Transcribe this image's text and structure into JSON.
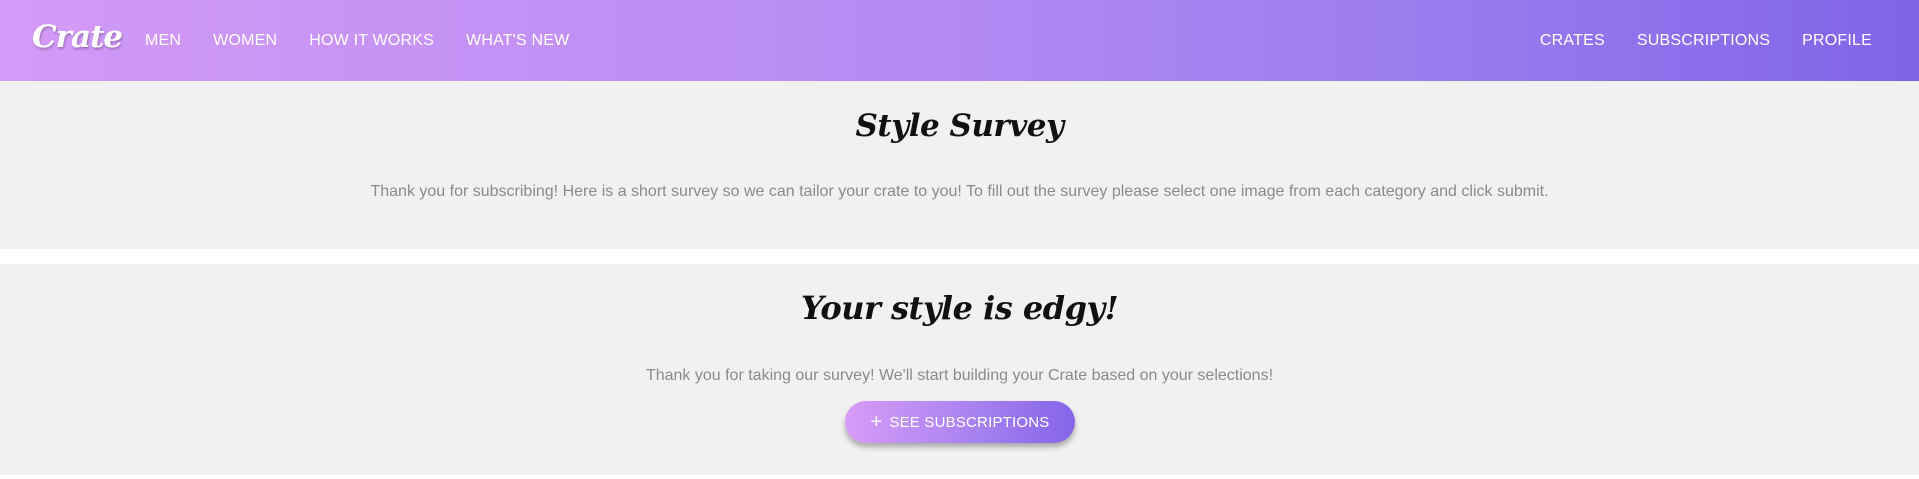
{
  "navbar": {
    "logo": "Crate",
    "left_links": [
      "MEN",
      "WOMEN",
      "HOW IT WORKS",
      "WHAT'S NEW"
    ],
    "right_links": [
      "CRATES",
      "SUBSCRIPTIONS",
      "PROFILE"
    ]
  },
  "survey": {
    "title": "Style Survey",
    "description": "Thank you for subscribing! Here is a short survey so we can tailor your crate to you! To fill out the survey please select one image from each category and click submit."
  },
  "result": {
    "title": "Your style is edgy!",
    "description": "Thank you for taking our survey! We'll start building your Crate based on your selections!",
    "button_label": "SEE SUBSCRIPTIONS",
    "button_icon": "plus-icon"
  },
  "colors": {
    "nav_gradient_start": "#d49af6",
    "nav_gradient_end": "#7f64e8",
    "section_background": "#f1f1f1",
    "description_text": "#8a8a8a"
  }
}
